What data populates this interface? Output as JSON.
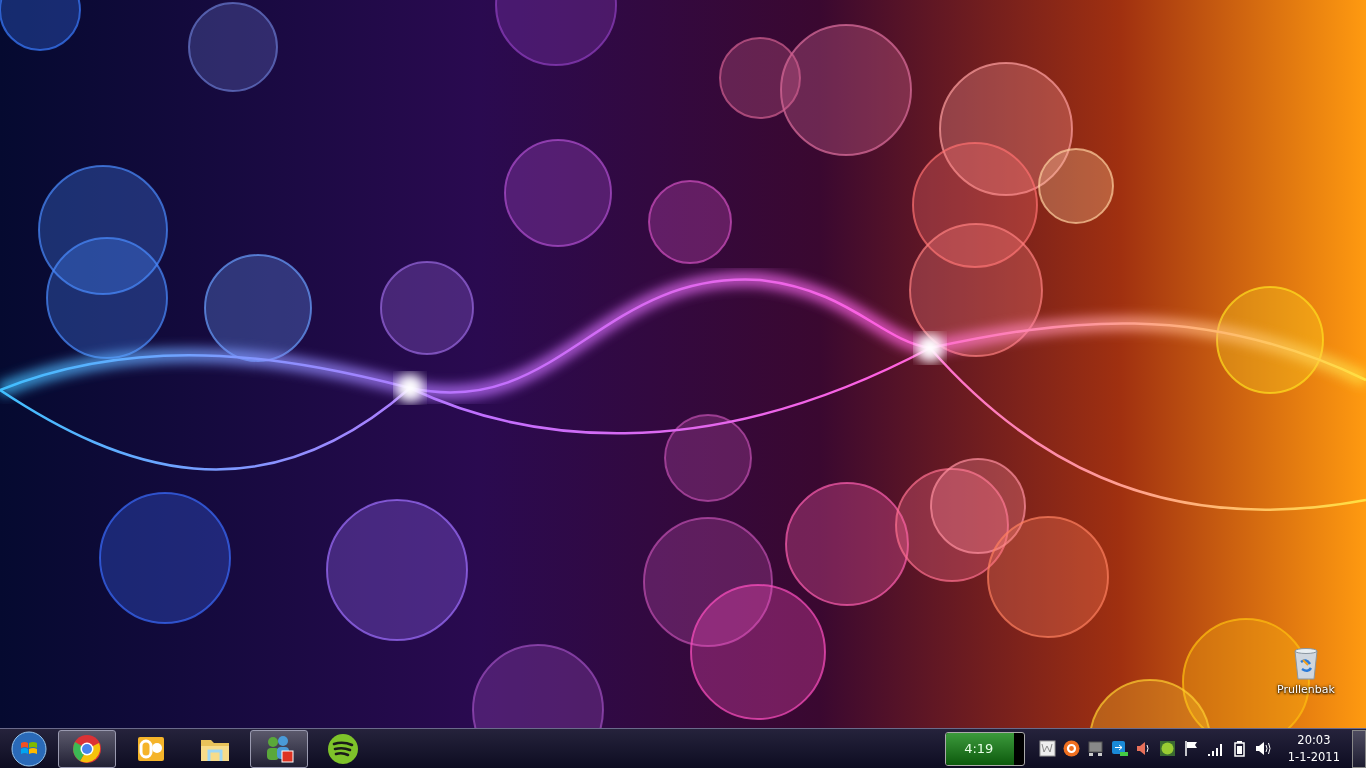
{
  "desktop": {
    "icons": [
      {
        "label": "Prullenbak"
      }
    ]
  },
  "taskbar": {
    "pinned": [
      {
        "kind": "chrome",
        "open": true
      },
      {
        "kind": "outlook",
        "open": false
      },
      {
        "kind": "explorer",
        "open": false
      },
      {
        "kind": "messenger",
        "open": true
      },
      {
        "kind": "spotify",
        "open": false
      }
    ],
    "media": {
      "time": "4:19",
      "level": 0.87
    },
    "clock": {
      "time": "20:03",
      "date": "1-1-2011"
    }
  }
}
